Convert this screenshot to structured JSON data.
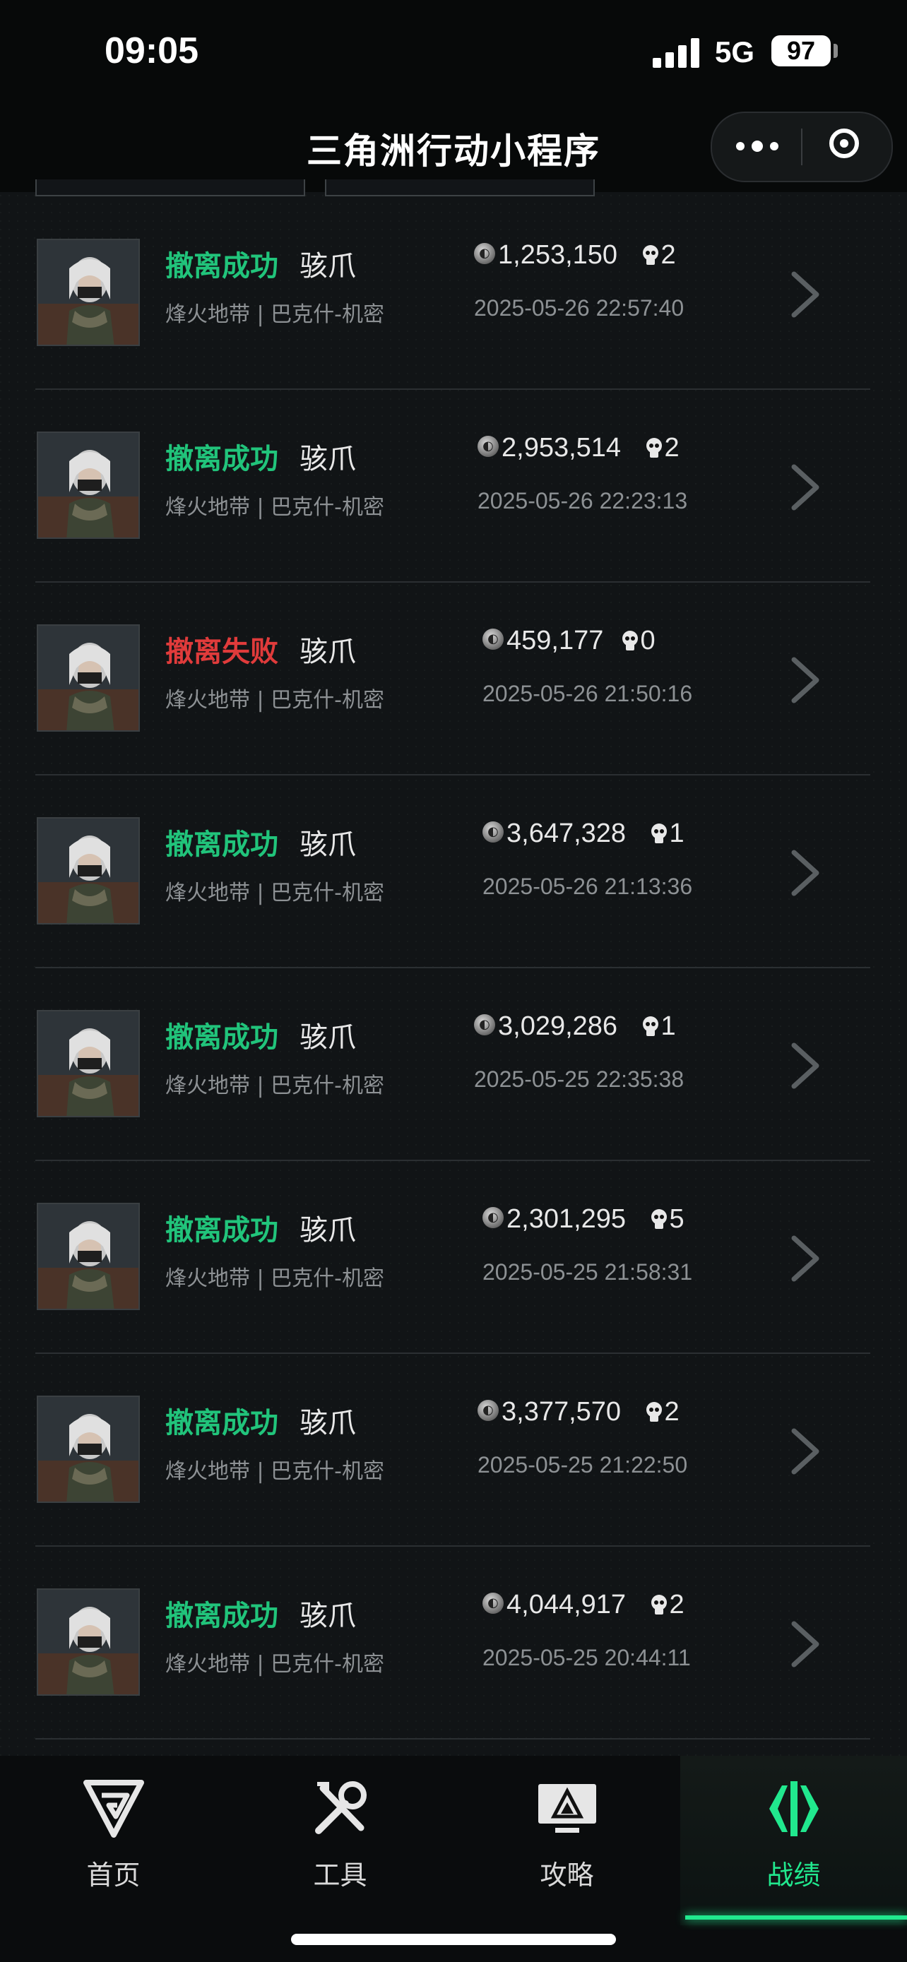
{
  "status_bar": {
    "time": "09:05",
    "network": "5G",
    "battery": "97"
  },
  "nav": {
    "title": "三角洲行动小程序"
  },
  "colors": {
    "success": "#21c47b",
    "fail": "#e03b3b",
    "accent": "#21e88e"
  },
  "records": [
    {
      "result": "撤离成功",
      "result_type": "success",
      "operator": "骇爪",
      "map": "烽火地带 | 巴克什-机密",
      "value": "1,253,150",
      "kills": "2",
      "date": "2025-05-26 22:57:40"
    },
    {
      "result": "撤离成功",
      "result_type": "success",
      "operator": "骇爪",
      "map": "烽火地带 | 巴克什-机密",
      "value": "2,953,514",
      "kills": "2",
      "date": "2025-05-26 22:23:13"
    },
    {
      "result": "撤离失败",
      "result_type": "fail",
      "operator": "骇爪",
      "map": "烽火地带 | 巴克什-机密",
      "value": "459,177",
      "kills": "0",
      "date": "2025-05-26 21:50:16"
    },
    {
      "result": "撤离成功",
      "result_type": "success",
      "operator": "骇爪",
      "map": "烽火地带 | 巴克什-机密",
      "value": "3,647,328",
      "kills": "1",
      "date": "2025-05-26 21:13:36"
    },
    {
      "result": "撤离成功",
      "result_type": "success",
      "operator": "骇爪",
      "map": "烽火地带 | 巴克什-机密",
      "value": "3,029,286",
      "kills": "1",
      "date": "2025-05-25 22:35:38"
    },
    {
      "result": "撤离成功",
      "result_type": "success",
      "operator": "骇爪",
      "map": "烽火地带 | 巴克什-机密",
      "value": "2,301,295",
      "kills": "5",
      "date": "2025-05-25 21:58:31"
    },
    {
      "result": "撤离成功",
      "result_type": "success",
      "operator": "骇爪",
      "map": "烽火地带 | 巴克什-机密",
      "value": "3,377,570",
      "kills": "2",
      "date": "2025-05-25 21:22:50"
    },
    {
      "result": "撤离成功",
      "result_type": "success",
      "operator": "骇爪",
      "map": "烽火地带 | 巴克什-机密",
      "value": "4,044,917",
      "kills": "2",
      "date": "2025-05-25 20:44:11"
    }
  ],
  "tabs": [
    {
      "label": "首页",
      "icon": "home-logo-icon"
    },
    {
      "label": "工具",
      "icon": "tools-icon"
    },
    {
      "label": "攻略",
      "icon": "guide-monitor-icon"
    },
    {
      "label": "战绩",
      "icon": "record-icon",
      "active": true
    }
  ]
}
